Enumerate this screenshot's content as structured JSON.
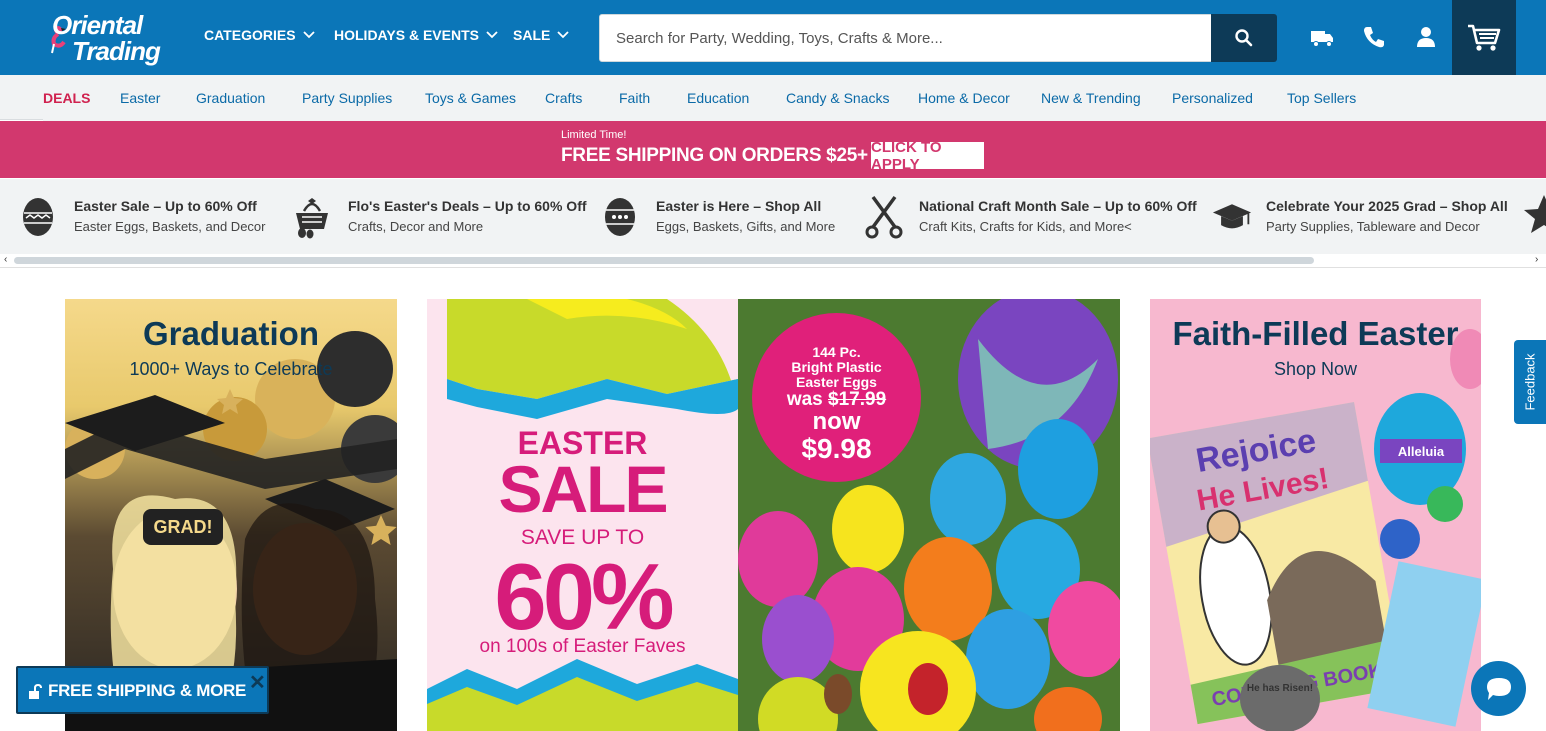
{
  "brand": {
    "line1": "Oriental",
    "line2": "Trading"
  },
  "topnav": [
    {
      "label": "CATEGORIES"
    },
    {
      "label": "HOLIDAYS & EVENTS"
    },
    {
      "label": "SALE"
    }
  ],
  "search": {
    "placeholder": "Search for Party, Wedding, Toys, Crafts & More..."
  },
  "header_icons": [
    "truck-icon",
    "phone-icon",
    "account-icon",
    "cart-icon"
  ],
  "categories": [
    "DEALS",
    "Easter",
    "Graduation",
    "Party Supplies",
    "Toys & Games",
    "Crafts",
    "Faith",
    "Education",
    "Candy & Snacks",
    "Home & Decor",
    "New & Trending",
    "Personalized",
    "Top Sellers"
  ],
  "promo": {
    "small": "Limited Time!",
    "big": "FREE SHIPPING ON ORDERS $25+",
    "cta": "CLICK TO APPLY"
  },
  "deals": [
    {
      "title": "Easter Sale – Up to 60% Off",
      "subtitle": "Easter Eggs, Baskets, and Decor",
      "icon": "easter-egg-icon"
    },
    {
      "title": "Flo's Easter's Deals – Up to 60% Off",
      "subtitle": "Crafts, Decor and More",
      "icon": "basket-icon"
    },
    {
      "title": "Easter is Here – Shop All",
      "subtitle": "Eggs, Baskets, Gifts, and More",
      "icon": "easter-egg-icon"
    },
    {
      "title": "National Craft Month Sale – Up to 60% Off",
      "subtitle": "Craft Kits, Crafts for Kids, and More<",
      "icon": "scissors-icon"
    },
    {
      "title": "Celebrate Your 2025 Grad – Shop All",
      "subtitle": "Party Supplies, Tableware and Decor",
      "icon": "grad-cap-icon"
    }
  ],
  "hero": {
    "graduation": {
      "title": "Graduation",
      "subtitle": "1000+ Ways to Celebrate",
      "prop_sign": "GRAD!"
    },
    "easter": {
      "line1": "EASTER",
      "line2": "SALE",
      "line3": "SAVE UP TO",
      "line4": "60%",
      "line5": "on 100s of Easter Faves",
      "badge_line1": "144 Pc.",
      "badge_line2": "Bright Plastic",
      "badge_line3": "Easter Eggs",
      "badge_was": "was",
      "badge_old_price": "$17.99",
      "badge_now": "now",
      "badge_price": "$9.98"
    },
    "faith": {
      "title": "Faith-Filled Easter",
      "subtitle": "Shop Now",
      "book_title1": "Rejoice",
      "book_title2": "He Lives!",
      "book_footer": "COLORING BOOK",
      "egg_label": "Alleluia",
      "stone_label": "He has Risen!"
    }
  },
  "feedback": "Feedback",
  "freeship": "FREE SHIPPING & MORE",
  "colors": {
    "header": "#0b76b8",
    "navy": "#0d3a57",
    "promo": "#d2386e",
    "deals_red": "#d0224f",
    "easter_pink": "#d61c7a"
  }
}
